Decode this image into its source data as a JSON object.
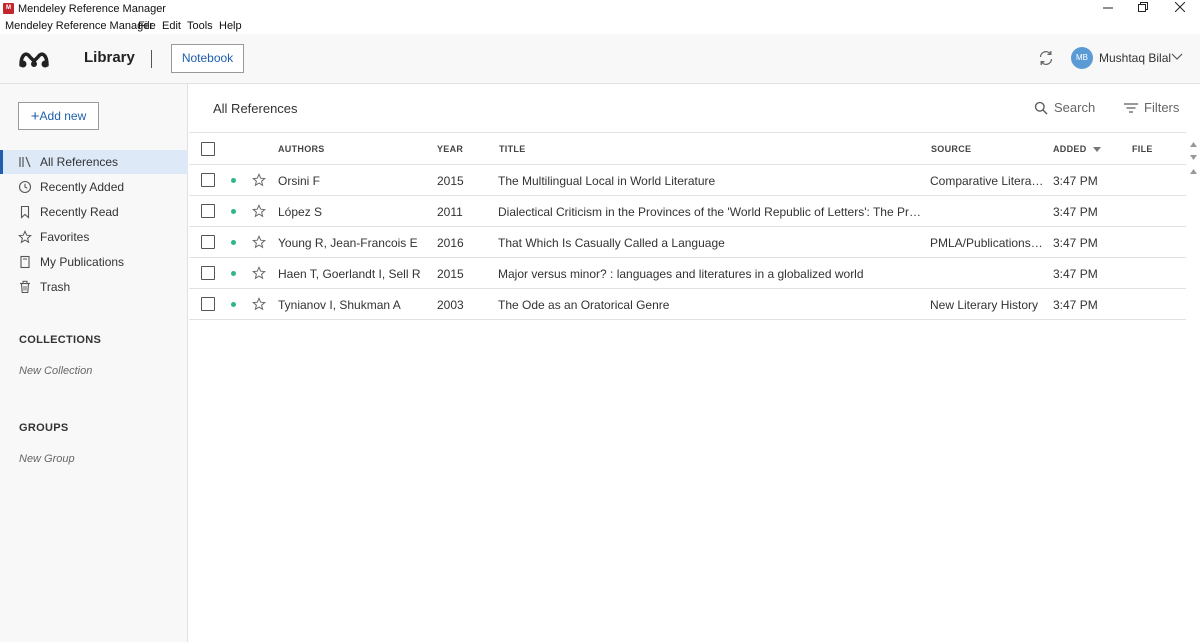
{
  "window": {
    "title": "Mendeley Reference Manager",
    "icon_label": "M"
  },
  "menu": [
    "Mendeley Reference Manager",
    "File",
    "Edit",
    "Tools",
    "Help"
  ],
  "header": {
    "library_label": "Library",
    "notebook_label": "Notebook",
    "user_initials": "MB",
    "user_name": "Mushtaq Bilal"
  },
  "sidebar": {
    "add_new_label": "Add new",
    "items": [
      {
        "label": "All References",
        "icon": "library-icon",
        "active": true
      },
      {
        "label": "Recently Added",
        "icon": "clock-icon"
      },
      {
        "label": "Recently Read",
        "icon": "bookmark-icon"
      },
      {
        "label": "Favorites",
        "icon": "star-icon"
      },
      {
        "label": "My Publications",
        "icon": "publication-icon"
      },
      {
        "label": "Trash",
        "icon": "trash-icon"
      }
    ],
    "collections_title": "COLLECTIONS",
    "new_collection_label": "New Collection",
    "groups_title": "GROUPS",
    "new_group_label": "New Group"
  },
  "main": {
    "title": "All References",
    "search_label": "Search",
    "filters_label": "Filters",
    "columns": {
      "authors": "AUTHORS",
      "year": "YEAR",
      "title": "TITLE",
      "source": "SOURCE",
      "added": "ADDED",
      "file": "FILE"
    },
    "rows": [
      {
        "authors": "Orsini F",
        "year": "2015",
        "title": "The Multilingual Local in World Literature",
        "source": "Comparative Literat…",
        "added": "3:47 PM"
      },
      {
        "authors": "López S",
        "year": "2011",
        "title": "Dialectical Criticism in the Provinces of the 'World Republic of Letters': The Primacy …",
        "source": "",
        "added": "3:47 PM"
      },
      {
        "authors": "Young R, Jean-Francois E",
        "year": "2016",
        "title": "That Which Is Casually Called a Language",
        "source": "PMLA/Publications …",
        "added": "3:47 PM"
      },
      {
        "authors": "Haen T, Goerlandt I, Sell R",
        "year": "2015",
        "title": "Major versus minor? : languages and literatures in a globalized world",
        "source": "",
        "added": "3:47 PM"
      },
      {
        "authors": "Tynianov I, Shukman A",
        "year": "2003",
        "title": "The Ode as an Oratorical Genre",
        "source": "New Literary History",
        "added": "3:47 PM"
      }
    ]
  },
  "colors": {
    "accent": "#1f5fae",
    "unread_dot": "#2fb58c",
    "active_bg": "#dde9f7",
    "avatar": "#5b9bd5"
  }
}
